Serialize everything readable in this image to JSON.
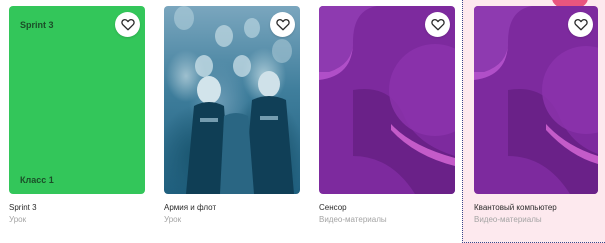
{
  "cards": [
    {
      "image_top_label": "Sprint 3",
      "image_bottom_label": "Класс 1",
      "title": "Sprint 3",
      "subtitle": "Урок",
      "icon": "heart-icon"
    },
    {
      "title": "Армия и флот",
      "subtitle": "Урок",
      "icon": "heart-icon"
    },
    {
      "title": "Сенсор",
      "subtitle": "Видео-материалы",
      "icon": "heart-icon"
    },
    {
      "title": "Квантовый компьютер",
      "subtitle": "Видео-материалы",
      "icon": "heart-icon"
    }
  ],
  "colors": {
    "green_card": "#33c65a",
    "purple_card": "#7d2a9e",
    "highlight_bg": "#fde9ee",
    "accent_badge": "#e8557e"
  }
}
